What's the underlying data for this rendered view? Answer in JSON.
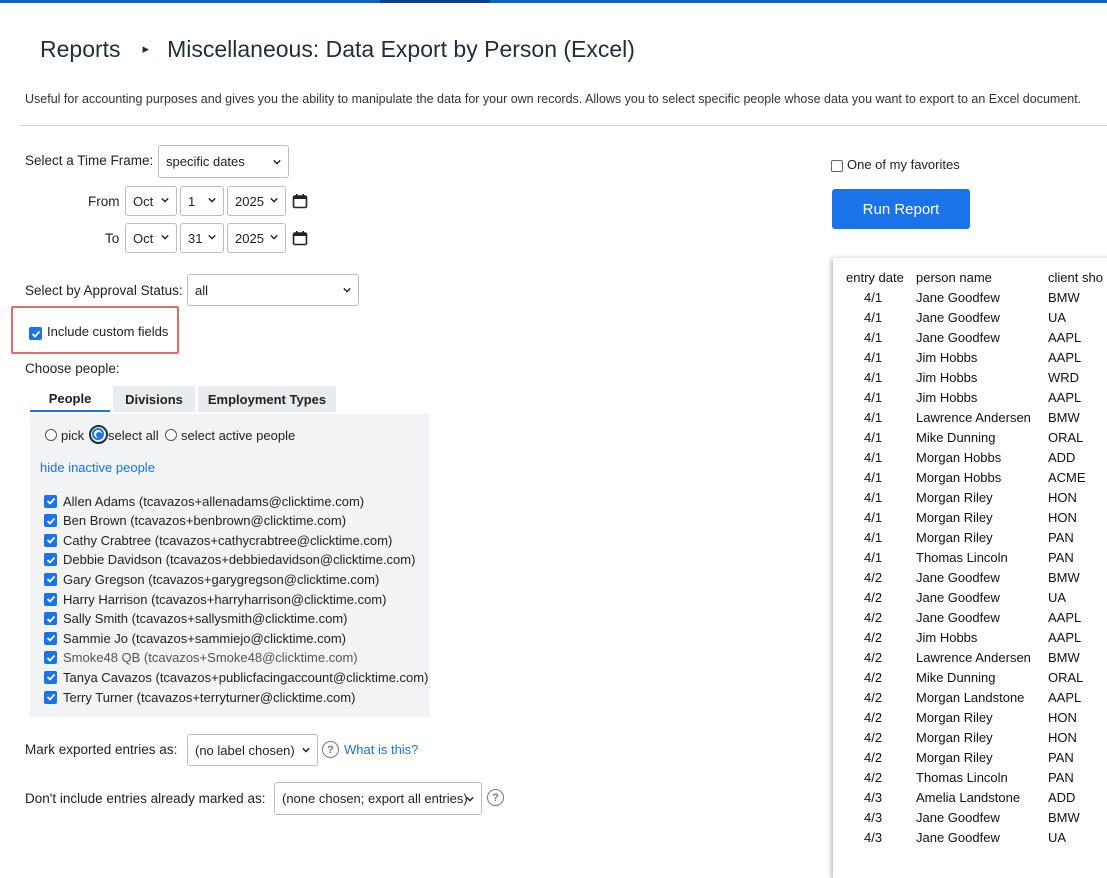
{
  "breadcrumb": {
    "root": "Reports",
    "separator": "▸",
    "title": "Miscellaneous: Data Export by Person (Excel)"
  },
  "description": "Useful for accounting purposes and gives you the ability to manipulate the data for your own records. Allows you to select specific people whose data you want to export to an Excel document.",
  "time_frame": {
    "label": "Select a Time Frame:",
    "value": "specific dates",
    "from_label": "From",
    "from": {
      "month": "Oct",
      "day": "1",
      "year": "2025"
    },
    "to_label": "To",
    "to": {
      "month": "Oct",
      "day": "31",
      "year": "2025"
    }
  },
  "favorites_label": "One of my favorites",
  "run_report_label": "Run Report",
  "approval": {
    "label": "Select by Approval Status:",
    "value": "all"
  },
  "custom_fields_label": "Include custom fields",
  "choose_people_label": "Choose people:",
  "tabs": [
    "People",
    "Divisions",
    "Employment Types"
  ],
  "selection": {
    "pick": "pick",
    "select_all": "select all",
    "select_active": "select active people"
  },
  "hide_inactive_label": "hide inactive people",
  "people": [
    {
      "name": "Allen Adams (tcavazos+allenadams@clicktime.com)"
    },
    {
      "name": "Ben Brown (tcavazos+benbrown@clicktime.com)"
    },
    {
      "name": "Cathy Crabtree (tcavazos+cathycrabtree@clicktime.com)"
    },
    {
      "name": "Debbie Davidson (tcavazos+debbiedavidson@clicktime.com)"
    },
    {
      "name": "Gary Gregson (tcavazos+garygregson@clicktime.com)"
    },
    {
      "name": "Harry Harrison (tcavazos+harryharrison@clicktime.com)"
    },
    {
      "name": "Sally Smith (tcavazos+sallysmith@clicktime.com)"
    },
    {
      "name": "Sammie Jo (tcavazos+sammiejo@clicktime.com)"
    },
    {
      "name": "Smoke48 QB (tcavazos+Smoke48@clicktime.com)"
    },
    {
      "name": "Tanya Cavazos (tcavazos+publicfacingaccount@clicktime.com)"
    },
    {
      "name": "Terry Turner (tcavazos+terryturner@clicktime.com)"
    }
  ],
  "mark_exported": {
    "label": "Mark exported entries as:",
    "value": "(no label chosen)",
    "help_link": "What is this?"
  },
  "dont_include": {
    "label": "Don't include entries already marked as:",
    "value": "(none chosen; export all entries)"
  },
  "preview": {
    "headers": [
      "entry date",
      "person name",
      "client sho"
    ],
    "rows": [
      [
        "4/1",
        "Jane Goodfew",
        "BMW"
      ],
      [
        "4/1",
        "Jane Goodfew",
        "UA"
      ],
      [
        "4/1",
        "Jane Goodfew",
        "AAPL"
      ],
      [
        "4/1",
        "Jim Hobbs",
        "AAPL"
      ],
      [
        "4/1",
        "Jim Hobbs",
        "WRD"
      ],
      [
        "4/1",
        "Jim Hobbs",
        "AAPL"
      ],
      [
        "4/1",
        "Lawrence Andersen",
        "BMW"
      ],
      [
        "4/1",
        "Mike Dunning",
        "ORAL"
      ],
      [
        "4/1",
        "Morgan  Hobbs",
        "ADD"
      ],
      [
        "4/1",
        "Morgan  Hobbs",
        "ACME"
      ],
      [
        "4/1",
        "Morgan Riley",
        "HON"
      ],
      [
        "4/1",
        "Morgan Riley",
        "HON"
      ],
      [
        "4/1",
        "Morgan Riley",
        "PAN"
      ],
      [
        "4/1",
        "Thomas Lincoln",
        "PAN"
      ],
      [
        "4/2",
        "Jane Goodfew",
        "BMW"
      ],
      [
        "4/2",
        "Jane Goodfew",
        "UA"
      ],
      [
        "4/2",
        "Jane Goodfew",
        "AAPL"
      ],
      [
        "4/2",
        "Jim Hobbs",
        "AAPL"
      ],
      [
        "4/2",
        "Lawrence Andersen",
        "BMW"
      ],
      [
        "4/2",
        "Mike Dunning",
        "ORAL"
      ],
      [
        "4/2",
        "Morgan Landstone",
        "AAPL"
      ],
      [
        "4/2",
        "Morgan Riley",
        "HON"
      ],
      [
        "4/2",
        "Morgan Riley",
        "HON"
      ],
      [
        "4/2",
        "Morgan Riley",
        "PAN"
      ],
      [
        "4/2",
        "Thomas Lincoln",
        "PAN"
      ],
      [
        "4/3",
        "Amelia Landstone",
        "ADD"
      ],
      [
        "4/3",
        "Jane Goodfew",
        "BMW"
      ],
      [
        "4/3",
        "Jane Goodfew",
        "UA"
      ]
    ]
  }
}
